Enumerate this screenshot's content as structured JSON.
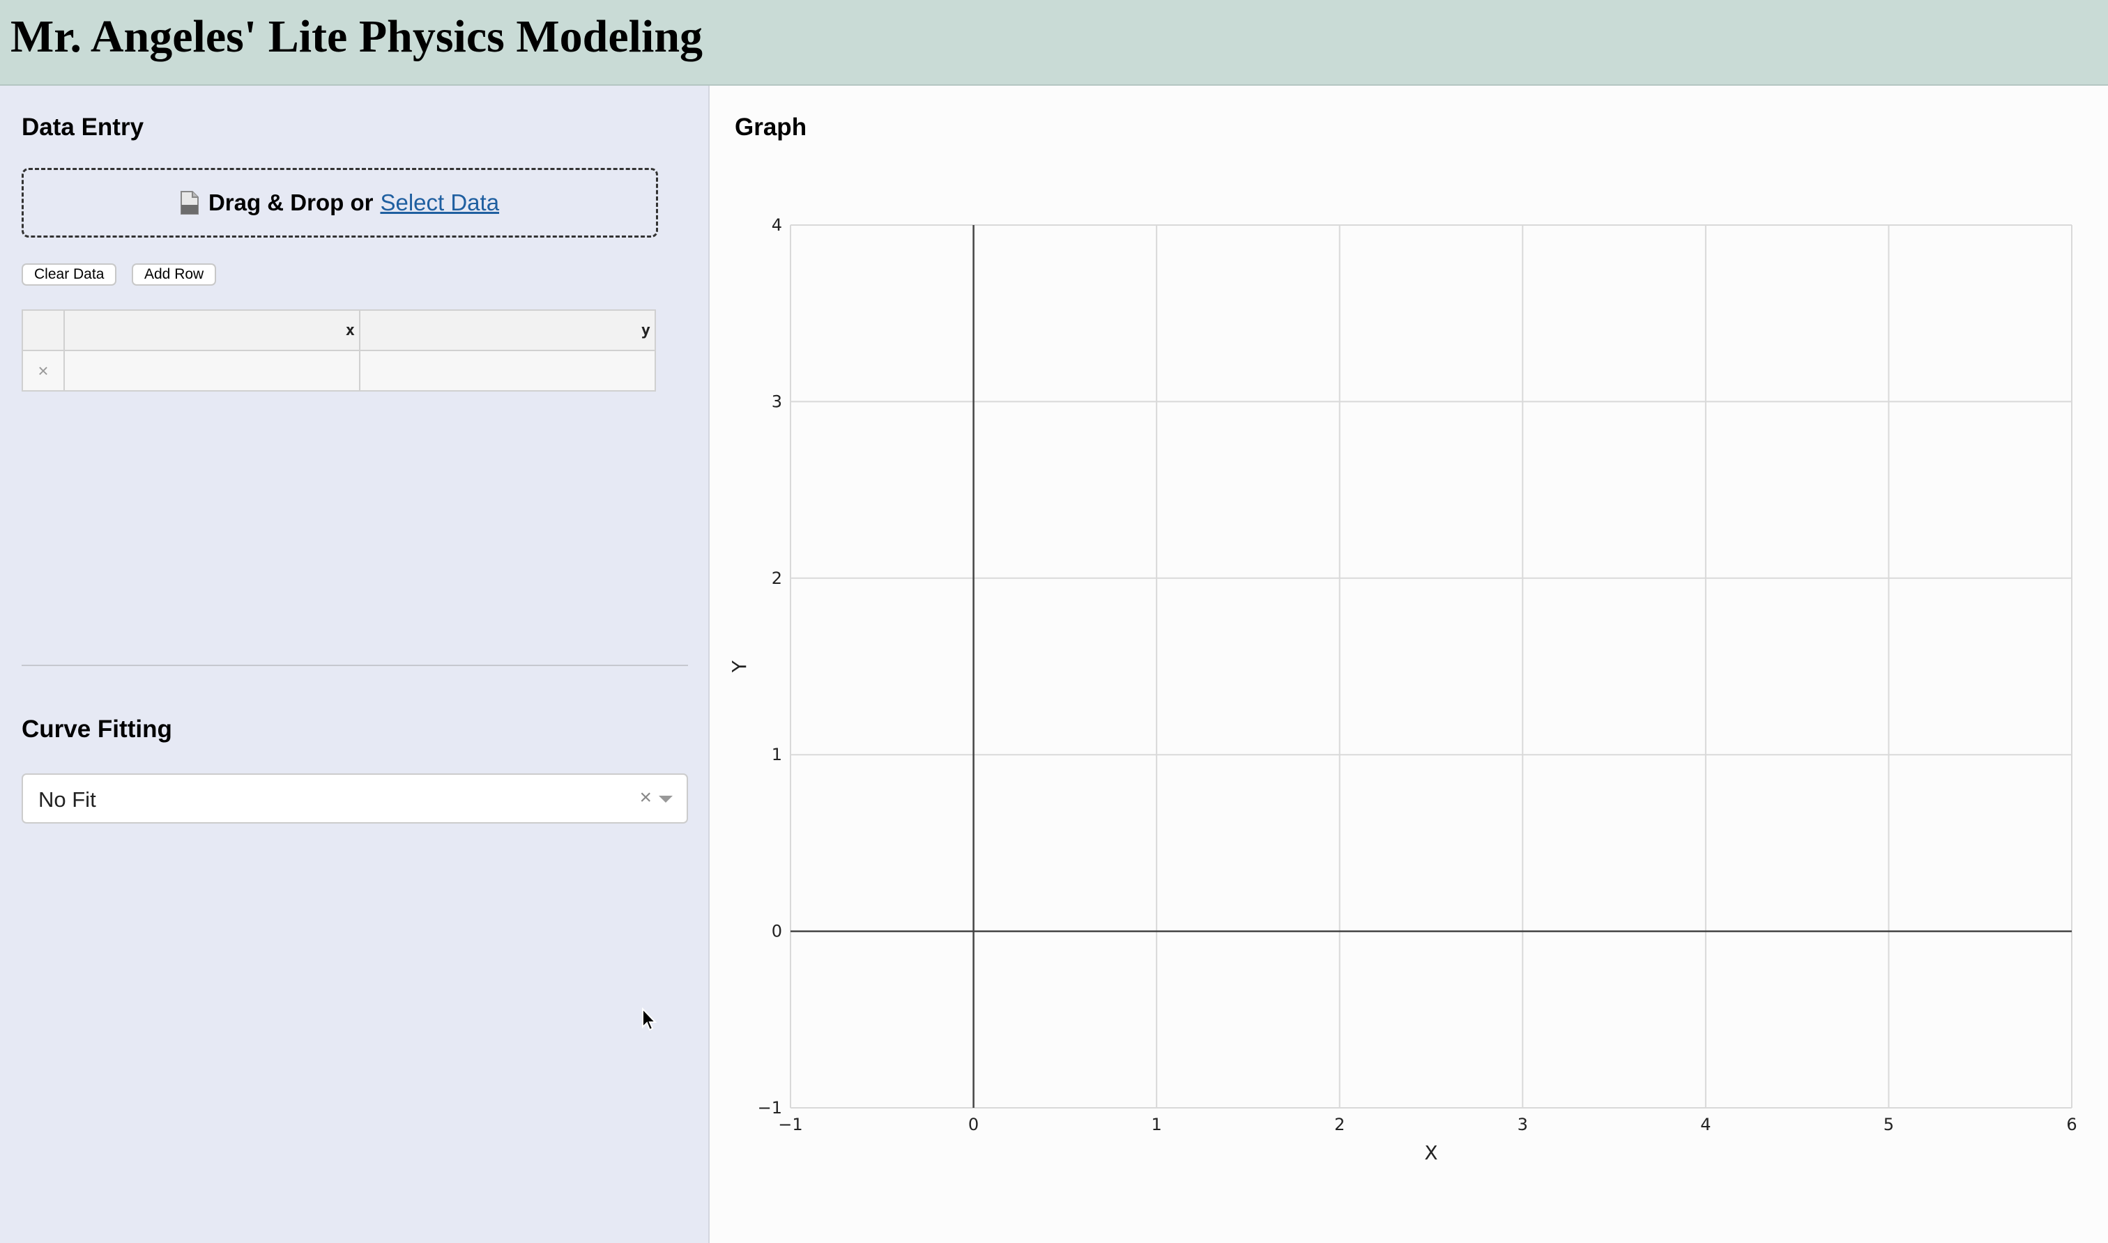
{
  "app": {
    "title": "Mr. Angeles' Lite Physics Modeling"
  },
  "data_entry": {
    "title": "Data Entry",
    "dropzone_text": "Drag & Drop or",
    "dropzone_link": "Select Data",
    "clear_button": "Clear Data",
    "add_row_button": "Add Row",
    "columns": [
      "",
      "x",
      "y"
    ],
    "rows": [
      {
        "delete_icon": "×",
        "x": "",
        "y": ""
      }
    ]
  },
  "curve_fitting": {
    "title": "Curve Fitting",
    "selected": "No Fit",
    "clear_icon": "×"
  },
  "graph": {
    "title": "Graph"
  },
  "chart_data": {
    "type": "scatter",
    "series": [],
    "xlabel": "X",
    "ylabel": "Y",
    "xlim": [
      -1,
      6
    ],
    "ylim": [
      -1,
      4
    ],
    "x_ticks": [
      -1,
      0,
      1,
      2,
      3,
      4,
      5,
      6
    ],
    "y_ticks": [
      -1,
      0,
      1,
      2,
      3,
      4
    ],
    "x_tick_labels": [
      "−1",
      "0",
      "1",
      "2",
      "3",
      "4",
      "5",
      "6"
    ],
    "y_tick_labels": [
      "−1",
      "0",
      "1",
      "2",
      "3",
      "4"
    ],
    "grid": true
  },
  "colors": {
    "header_bg": "#c9dbd6",
    "left_panel_bg": "#e6e9f4",
    "link": "#1f5fa0",
    "grid": "#d9d9d9",
    "zero_line": "#444444"
  }
}
